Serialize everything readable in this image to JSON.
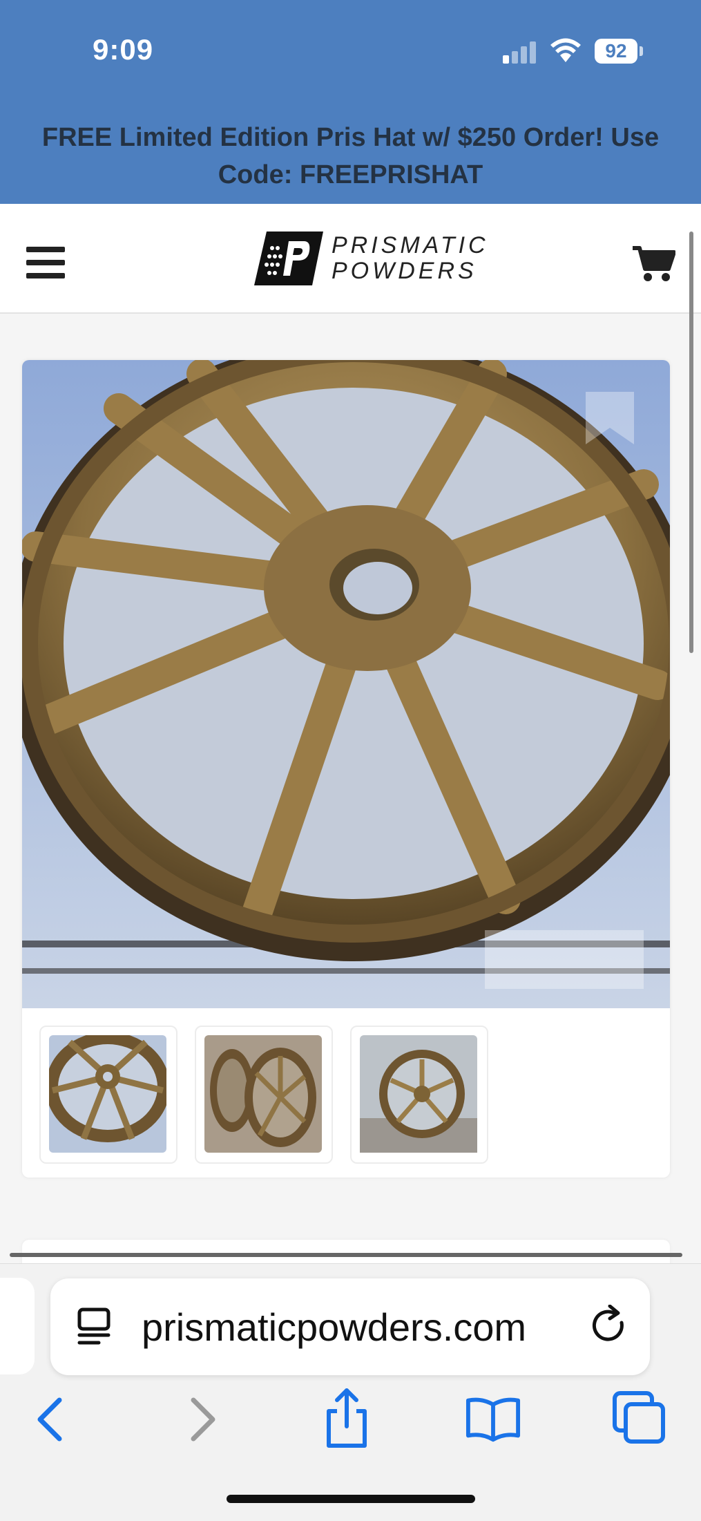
{
  "status_bar": {
    "time": "9:09",
    "battery": "92"
  },
  "promo_banner": {
    "text": "FREE Limited Edition Pris Hat w/ $250 Order! Use Code: FREEPRISHAT"
  },
  "header": {
    "menu_icon": "hamburger-menu-icon",
    "logo_line1": "PRISMATIC",
    "logo_line2": "POWDERS",
    "cart_icon": "shopping-cart-icon"
  },
  "product": {
    "thumbnails": [
      {
        "name": "thumbnail-1"
      },
      {
        "name": "thumbnail-2"
      },
      {
        "name": "thumbnail-3"
      }
    ]
  },
  "browser": {
    "url": "prismaticpowders.com",
    "toolbar": [
      "back-icon",
      "forward-icon",
      "share-icon",
      "bookmarks-icon",
      "tabs-icon"
    ]
  },
  "colors": {
    "banner": "#4d7fbf",
    "promo_text": "#243243",
    "accent_blue": "#1a73e8"
  }
}
